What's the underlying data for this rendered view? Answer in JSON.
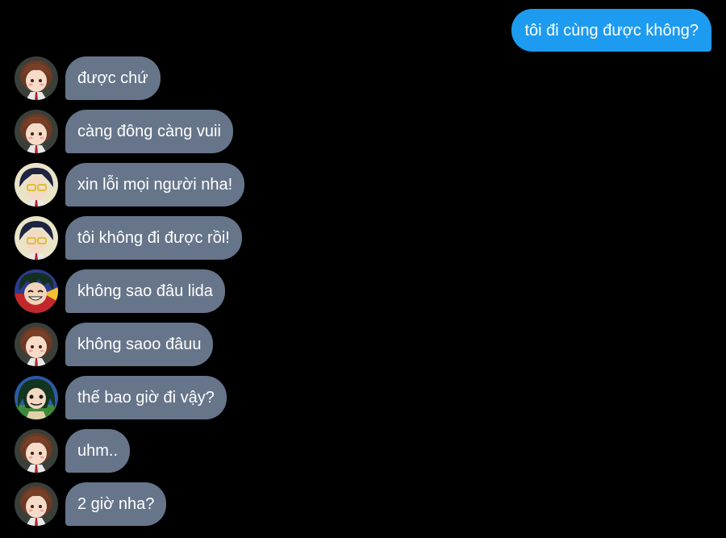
{
  "conversation": {
    "outgoing": [
      {
        "text": "tôi đi cùng được không?"
      }
    ],
    "incoming": [
      {
        "text": "được chứ",
        "avatar_icon": "brown-hair-girl-avatar-icon"
      },
      {
        "text": "càng đông càng vuii",
        "avatar_icon": "brown-hair-girl-avatar-icon"
      },
      {
        "text": "xin lỗi mọi người nha!",
        "avatar_icon": "glasses-boy-avatar-icon"
      },
      {
        "text": "tôi không đi được rồi!",
        "avatar_icon": "glasses-boy-avatar-icon"
      },
      {
        "text": "không sao đâu lida",
        "avatar_icon": "green-hair-boy-avatar-icon"
      },
      {
        "text": "không saoo đâuu",
        "avatar_icon": "brown-hair-girl-avatar-icon"
      },
      {
        "text": "thế bao giờ đi vậy?",
        "avatar_icon": "frog-girl-avatar-icon"
      },
      {
        "text": "uhm..",
        "avatar_icon": "brown-hair-girl-avatar-icon"
      },
      {
        "text": "2 giờ nha?",
        "avatar_icon": "brown-hair-girl-avatar-icon"
      }
    ]
  },
  "colors": {
    "background": "#000000",
    "outgoing_bubble": "#1d9bf0",
    "incoming_bubble": "#66758a",
    "text": "#ffffff"
  }
}
